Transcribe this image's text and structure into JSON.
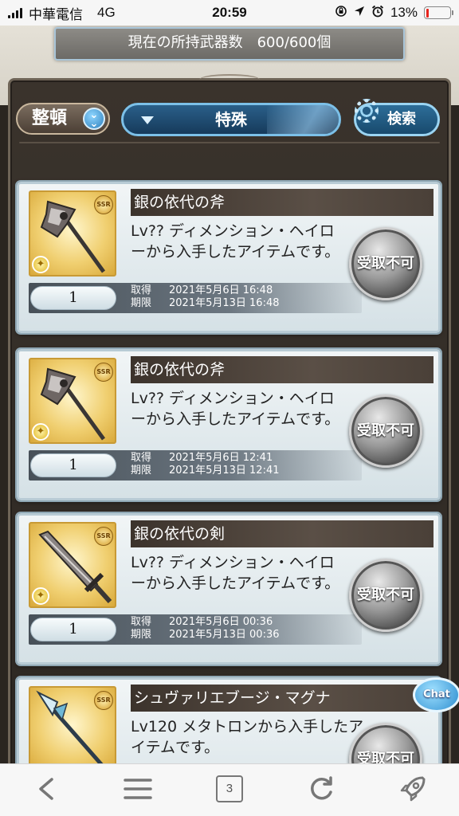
{
  "status_bar": {
    "carrier": "中華電信",
    "network": "4G",
    "time": "20:59",
    "battery": "13%",
    "battery_level": 0.13,
    "battery_color": "#e8241d"
  },
  "header": {
    "weapon_count": "現在の所持武器数　600/600個"
  },
  "controls": {
    "sort_label": "整頓",
    "filter_label": "特殊",
    "search_label": "検索"
  },
  "items": [
    {
      "name": "銀の依代の斧",
      "rarity": "SSR",
      "weapon_icon": "axe",
      "desc": "Lv?? ディメンション・ヘイローから入手したアイテムです。",
      "qty": "1",
      "acquired_label": "取得",
      "acquired": "2021年5月6日 16:48",
      "expiry_label": "期限",
      "expiry": "2021年5月13日 16:48",
      "button": "受取不可"
    },
    {
      "name": "銀の依代の斧",
      "rarity": "SSR",
      "weapon_icon": "axe",
      "desc": "Lv?? ディメンション・ヘイローから入手したアイテムです。",
      "qty": "1",
      "acquired_label": "取得",
      "acquired": "2021年5月6日 12:41",
      "expiry_label": "期限",
      "expiry": "2021年5月13日 12:41",
      "button": "受取不可"
    },
    {
      "name": "銀の依代の剣",
      "rarity": "SSR",
      "weapon_icon": "sword",
      "desc": "Lv?? ディメンション・ヘイローから入手したアイテムです。",
      "qty": "1",
      "acquired_label": "取得",
      "acquired": "2021年5月6日 00:36",
      "expiry_label": "期限",
      "expiry": "2021年5月13日 00:36",
      "button": "受取不可"
    },
    {
      "name": "シュヴァリエブージ・マグナ",
      "rarity": "SSR",
      "weapon_icon": "spear",
      "desc": "Lv120 メタトロンから入手したアイテムです。",
      "button": "受取不可"
    }
  ],
  "chat_label": "Chat",
  "toolbar": {
    "tab_count": "3",
    "icons": [
      "back-icon",
      "menu-icon",
      "tabs-icon",
      "reload-icon",
      "rocket-icon"
    ]
  }
}
